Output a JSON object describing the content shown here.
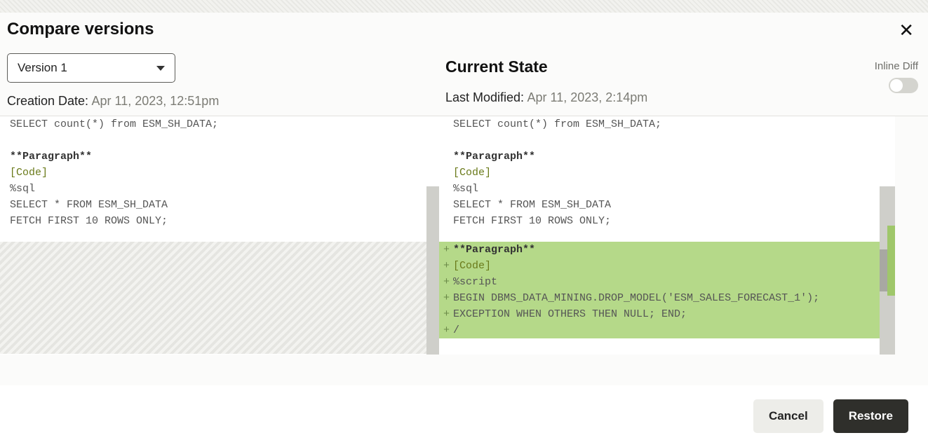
{
  "dialog": {
    "title": "Compare versions"
  },
  "left": {
    "version_label": "Version 1",
    "creation_label": "Creation Date:",
    "creation_value": "Apr 11, 2023, 12:51pm",
    "lines": {
      "l1": "SELECT count(*) from ESM_SH_DATA;",
      "l2": "**Paragraph**",
      "l3": "[Code]",
      "l4": "%sql",
      "l5": "SELECT * FROM ESM_SH_DATA",
      "l6": "FETCH FIRST 10 ROWS ONLY;"
    }
  },
  "right": {
    "title": "Current State",
    "modified_label": "Last Modified:",
    "modified_value": "Apr 11, 2023, 2:14pm",
    "lines": {
      "l1": "SELECT count(*) from ESM_SH_DATA;",
      "l2": "**Paragraph**",
      "l3": "[Code]",
      "l4": "%sql",
      "l5": "SELECT * FROM ESM_SH_DATA",
      "l6": "FETCH FIRST 10 ROWS ONLY;"
    },
    "added": {
      "a1": "**Paragraph**",
      "a2": "[Code]",
      "a3": "%script",
      "a4": "",
      "a5": "BEGIN DBMS_DATA_MINING.DROP_MODEL('ESM_SALES_FORECAST_1');",
      "a6": "EXCEPTION WHEN OTHERS THEN NULL; END;",
      "a7": "/"
    }
  },
  "inline_diff": {
    "label": "Inline Diff",
    "on": false
  },
  "footer": {
    "cancel": "Cancel",
    "restore": "Restore"
  }
}
